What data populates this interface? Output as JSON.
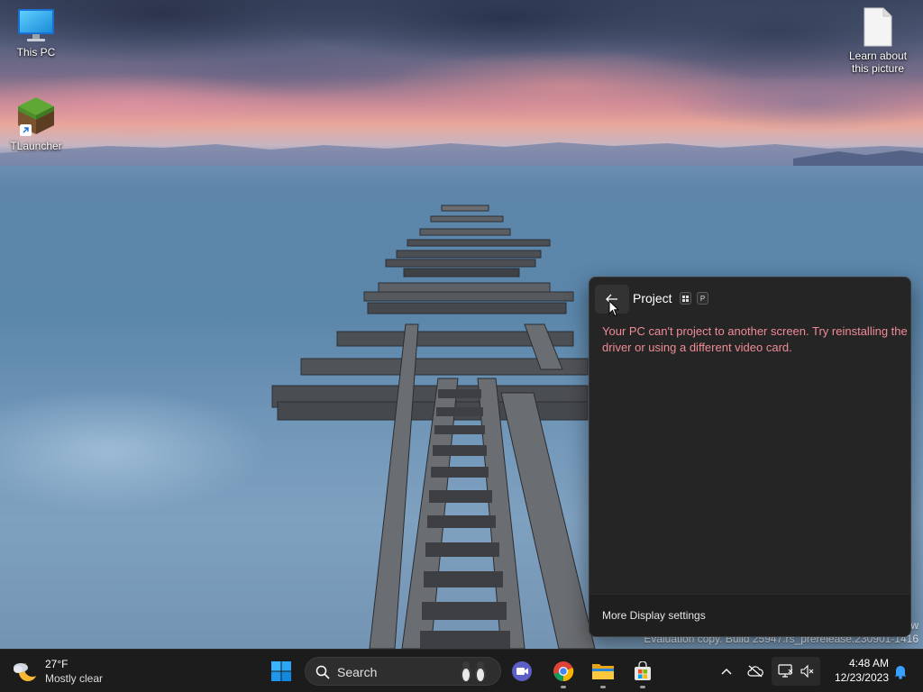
{
  "desktop": {
    "icons": [
      {
        "label": "This PC"
      },
      {
        "label": "TLauncher"
      },
      {
        "label": "Learn about this picture"
      }
    ]
  },
  "watermark": {
    "line1": "w",
    "line2": "Evaluation copy. Build 25947.rs_prerelease.230901-1416"
  },
  "project_flyout": {
    "title": "Project",
    "shortcut_keys": [
      "win-key",
      "P"
    ],
    "error_message": "Your PC can't project to another screen. Try reinstalling the driver or using a different video card.",
    "error_color": "#f08b96",
    "footer_link": "More Display settings"
  },
  "taskbar": {
    "weather": {
      "temperature": "27°F",
      "condition": "Mostly clear"
    },
    "search": {
      "placeholder": "Search"
    },
    "apps": [
      "start-icon",
      "search-icon",
      "meet-icon",
      "chrome-icon",
      "file-explorer-icon",
      "store-icon"
    ],
    "clock": {
      "time": "4:48 AM",
      "date": "12/23/2023"
    }
  },
  "colors": {
    "accent": "#0078d4",
    "flyout_bg": "#252525",
    "taskbar_bg": "#1c1c1c"
  }
}
